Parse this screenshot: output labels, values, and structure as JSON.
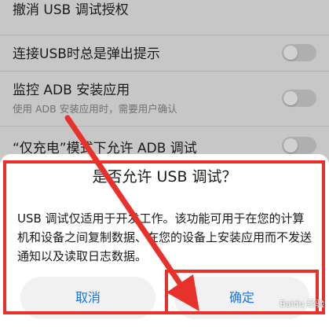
{
  "settings": {
    "revoke": {
      "title": "撤消 USB 调试授权"
    },
    "popup_on_connect": {
      "title": "连接USB时总是弹出提示"
    },
    "monitor_adb": {
      "title": "监控 ADB 安装应用",
      "subtitle": "使用 ADB 安装应用时，需要用户确认"
    },
    "charge_only_adb": {
      "title": "“仅充电”模式下允许 ADB 调试"
    }
  },
  "dialog": {
    "title": "是否允许 USB 调试？",
    "body": "USB 调试仅适用于开发工作。该功能可用于在您的计算机和设备之间复制数据、在您的设备上安装应用而不发送通知以及读取日志数据。",
    "cancel_label": "取消",
    "ok_label": "确定"
  },
  "annotation": {
    "highlight_color": "#e8312a",
    "watermark": "Baidu 经验"
  }
}
